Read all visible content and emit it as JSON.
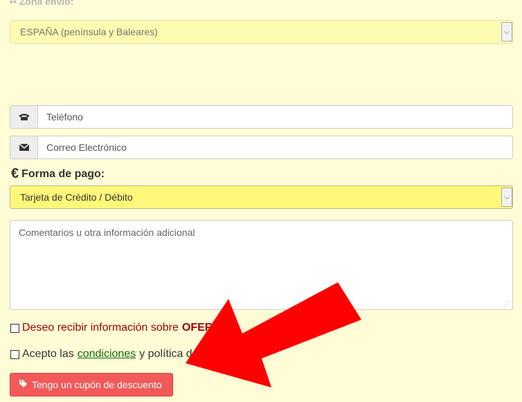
{
  "zona": {
    "label": "Zona envío:",
    "selected": "ESPAÑA (península y Baleares)"
  },
  "telefono": {
    "placeholder": "Teléfono",
    "icon": "phone-icon"
  },
  "correo": {
    "placeholder": "Correo Electrónico",
    "icon": "envelope-icon"
  },
  "pago": {
    "symbol": "€",
    "heading": "Forma de pago:",
    "selected": "Tarjeta de Crédito / Débito"
  },
  "comentarios": {
    "placeholder": "Comentarios u otra información adicional"
  },
  "ofertas": {
    "text": "Deseo recibir información sobre",
    "bold": "OFER"
  },
  "condiciones": {
    "prefix": "Acepto las",
    "link": "condiciones",
    "suffix": "y política d"
  },
  "coupon": {
    "label": "Tengo un cupón de descuento",
    "icon": "tag-icon"
  },
  "colors": {
    "background": "#fffcd6",
    "select_highlight": "#fff87a",
    "coupon_bg": "#f25a5a",
    "arrow": "#ff0000"
  }
}
